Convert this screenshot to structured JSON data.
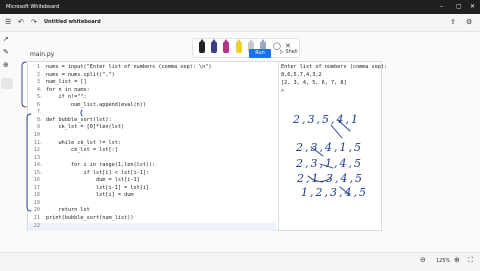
{
  "window": {
    "title": "Microsoft Whiteboard"
  },
  "toolbar": {
    "document_name": "Untitled whiteboard"
  },
  "editor": {
    "tab_label": "main.py",
    "run_label": "Run",
    "shell_label": "Shell",
    "lines": [
      {
        "num": "1",
        "code": "nums = input(\"Enter list of numbers (comma sep): \\n\")"
      },
      {
        "num": "2",
        "code": "nums = nums.split(\",\")"
      },
      {
        "num": "3",
        "code": "num_list = []"
      },
      {
        "num": "4",
        "code": "for n in nums:"
      },
      {
        "num": "5",
        "code": "    if n!=\"\":"
      },
      {
        "num": "6",
        "code": "        num_list.append(eval(n))"
      },
      {
        "num": "7",
        "code": ""
      },
      {
        "num": "8",
        "code": "def bubble_sort(lst):"
      },
      {
        "num": "9",
        "code": "    ck_lst = [0]*len(lst)"
      },
      {
        "num": "10",
        "code": ""
      },
      {
        "num": "11",
        "code": "    while ck_lst != lst:"
      },
      {
        "num": "12",
        "code": "        ck_lst = lst[:]"
      },
      {
        "num": "13",
        "code": ""
      },
      {
        "num": "14",
        "code": "        for i in range(1,len(lst)):"
      },
      {
        "num": "15",
        "code": "            if lst[i] < lst[i-1]:"
      },
      {
        "num": "16",
        "code": "                dum = lst[i-1]"
      },
      {
        "num": "17",
        "code": "                lst[i-1] = lst[i]"
      },
      {
        "num": "18",
        "code": "                lst[i] = dum"
      },
      {
        "num": "19",
        "code": ""
      },
      {
        "num": "20",
        "code": "    return lst"
      },
      {
        "num": "21",
        "code": "print(bubble_sort(num_list))"
      },
      {
        "num": "22",
        "code": ""
      }
    ]
  },
  "shell": {
    "lines": [
      "Enter list of numbers (comma sep):",
      "8,6,5,7,4,3,2",
      "[2, 3, 4, 5, 6, 7, 8]",
      ">"
    ]
  },
  "handwriting": {
    "rows": [
      "2,3,5,4,1",
      "2,3,4,1,5",
      "2,3,1,4,5",
      "2,1,3,4,5",
      "1,2,3,4,5"
    ]
  },
  "statusbar": {
    "zoom": "125%"
  },
  "colors": {
    "accent": "#1a73e8",
    "annotation": "#1f3a8a"
  }
}
